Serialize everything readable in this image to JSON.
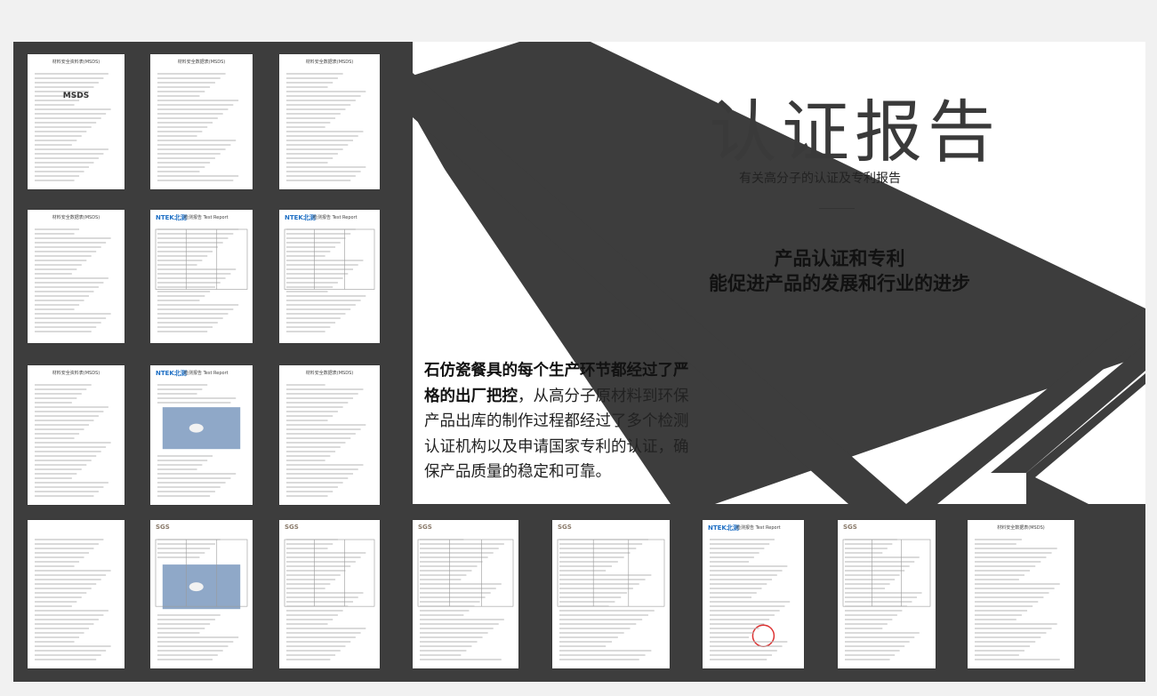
{
  "hero": {
    "title": "认证报告",
    "subtitle": "有关高分子的认证及专利报告",
    "slogan_line1": "产品认证和专利",
    "slogan_line2": "能促进产品的发展和行业的进步",
    "description_bold": "石仿瓷餐具的每个生产环节都经过了严格的出厂把控",
    "description_rest": "，从高分子原材料到环保产品出库的制作过程都经过了多个检测认证机构以及申请国家专利的认证，确保产品质量的稳定和可靠。"
  },
  "documents": [
    {
      "header": "材料安全资料表(MSDS)",
      "logo": "",
      "kind": "msds",
      "big": "MSDS"
    },
    {
      "header": "材料安全数据表(MSDS)",
      "logo": "",
      "kind": "msds",
      "big": ""
    },
    {
      "header": "材料安全数据表(MSDS)",
      "logo": "",
      "kind": "msds",
      "big": ""
    },
    {
      "header": "材料安全数据表(MSDS)",
      "logo": "",
      "kind": "msds",
      "big": ""
    },
    {
      "header": "检测报告 Test Report",
      "logo": "NTEK北测",
      "kind": "ntek",
      "big": ""
    },
    {
      "header": "检测报告 Test Report",
      "logo": "NTEK北测",
      "kind": "ntek",
      "big": ""
    },
    {
      "header": "材料安全资料表(MSDS)",
      "logo": "",
      "kind": "msds",
      "big": ""
    },
    {
      "header": "检测报告 Test Report",
      "logo": "NTEK北测",
      "kind": "ntek-photo",
      "big": ""
    },
    {
      "header": "材料安全数据表(MSDS)",
      "logo": "",
      "kind": "msds",
      "big": ""
    },
    {
      "header": "",
      "logo": "",
      "kind": "patent",
      "big": ""
    },
    {
      "header": "",
      "logo": "SGS",
      "kind": "sgs-photo",
      "big": ""
    },
    {
      "header": "",
      "logo": "SGS",
      "kind": "sgs",
      "big": ""
    },
    {
      "header": "",
      "logo": "SGS",
      "kind": "sgs-short",
      "big": ""
    },
    {
      "header": "",
      "logo": "SGS",
      "kind": "sgs",
      "big": ""
    },
    {
      "header": "检测报告 Test Report",
      "logo": "NTEK北测",
      "kind": "ntek-stamp",
      "big": ""
    },
    {
      "header": "",
      "logo": "SGS",
      "kind": "sgs",
      "big": ""
    },
    {
      "header": "材料安全数据表(MSDS)",
      "logo": "",
      "kind": "msds",
      "big": ""
    }
  ],
  "colors": {
    "frame": "#3d3d3d",
    "hero_bg": "#ffffff",
    "diagonal": "#3d3d3d",
    "page_bg": "#f1f1f1"
  }
}
